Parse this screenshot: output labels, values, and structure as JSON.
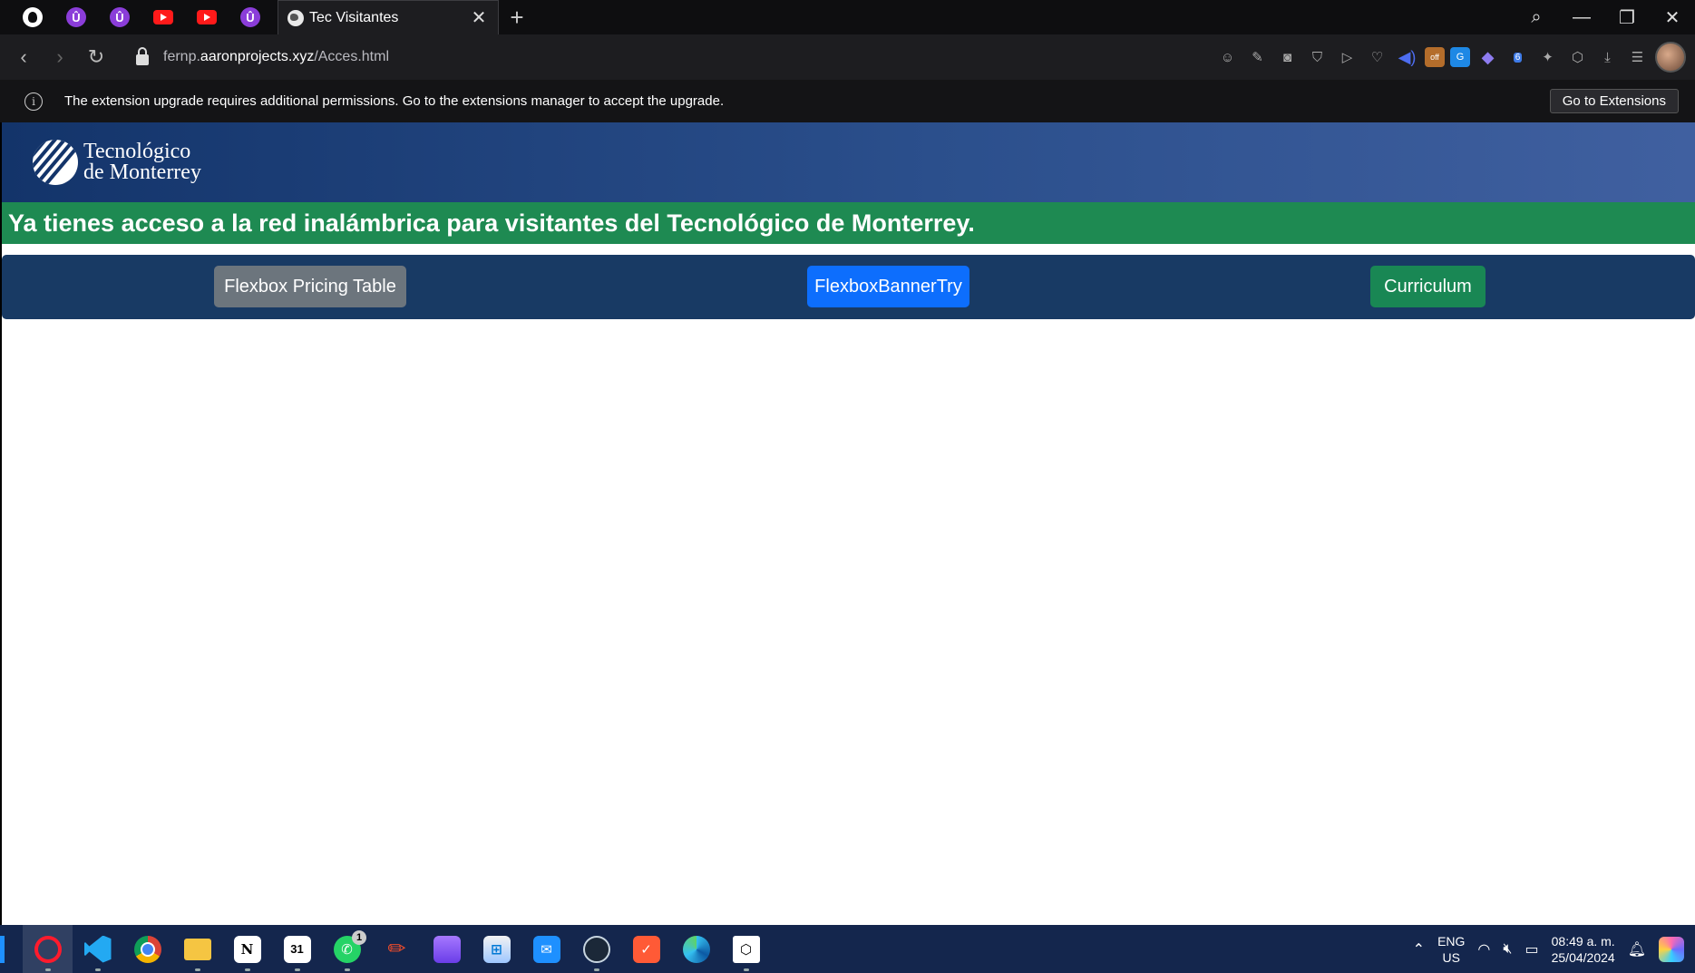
{
  "browser": {
    "pinned_tabs": [
      {
        "icon": "github-icon"
      },
      {
        "icon": "purple-u-icon",
        "letter": "Û"
      },
      {
        "icon": "purple-u-icon",
        "letter": "Û"
      },
      {
        "icon": "youtube-icon"
      },
      {
        "icon": "youtube-icon"
      },
      {
        "icon": "purple-u-icon",
        "letter": "Û"
      }
    ],
    "active_tab": {
      "title": "Tec Visitantes"
    },
    "url_prefix": "fernp.",
    "url_domain": "aaronprojects.xyz",
    "url_path": "/Acces.html",
    "extension_badge_off": "off",
    "extension_badge_count": "6"
  },
  "notification": {
    "message": "The extension upgrade requires additional permissions. Go to the extensions manager to accept the upgrade.",
    "button_label": "Go to Extensions"
  },
  "page": {
    "logo_line1": "Tecnológico",
    "logo_line2": "de Monterrey",
    "banner_text": "Ya tienes acceso a la red inalámbrica para visitantes del Tecnológico de Monterrey.",
    "buttons": {
      "pricing": "Flexbox Pricing Table",
      "banner": "FlexboxBannerTry",
      "curriculum": "Curriculum"
    }
  },
  "taskbar": {
    "whatsapp_badge": "1",
    "notion_letter": "N",
    "calendar_day": "31",
    "lang_line1": "ENG",
    "lang_line2": "US",
    "time": "08:49 a. m.",
    "date": "25/04/2024"
  },
  "colors": {
    "header_blue": "#13346a",
    "banner_green": "#1e8a52",
    "nav_band": "#183a64",
    "btn_gray": "#6c757d",
    "btn_blue": "#0d6efd",
    "btn_green": "#198754"
  }
}
